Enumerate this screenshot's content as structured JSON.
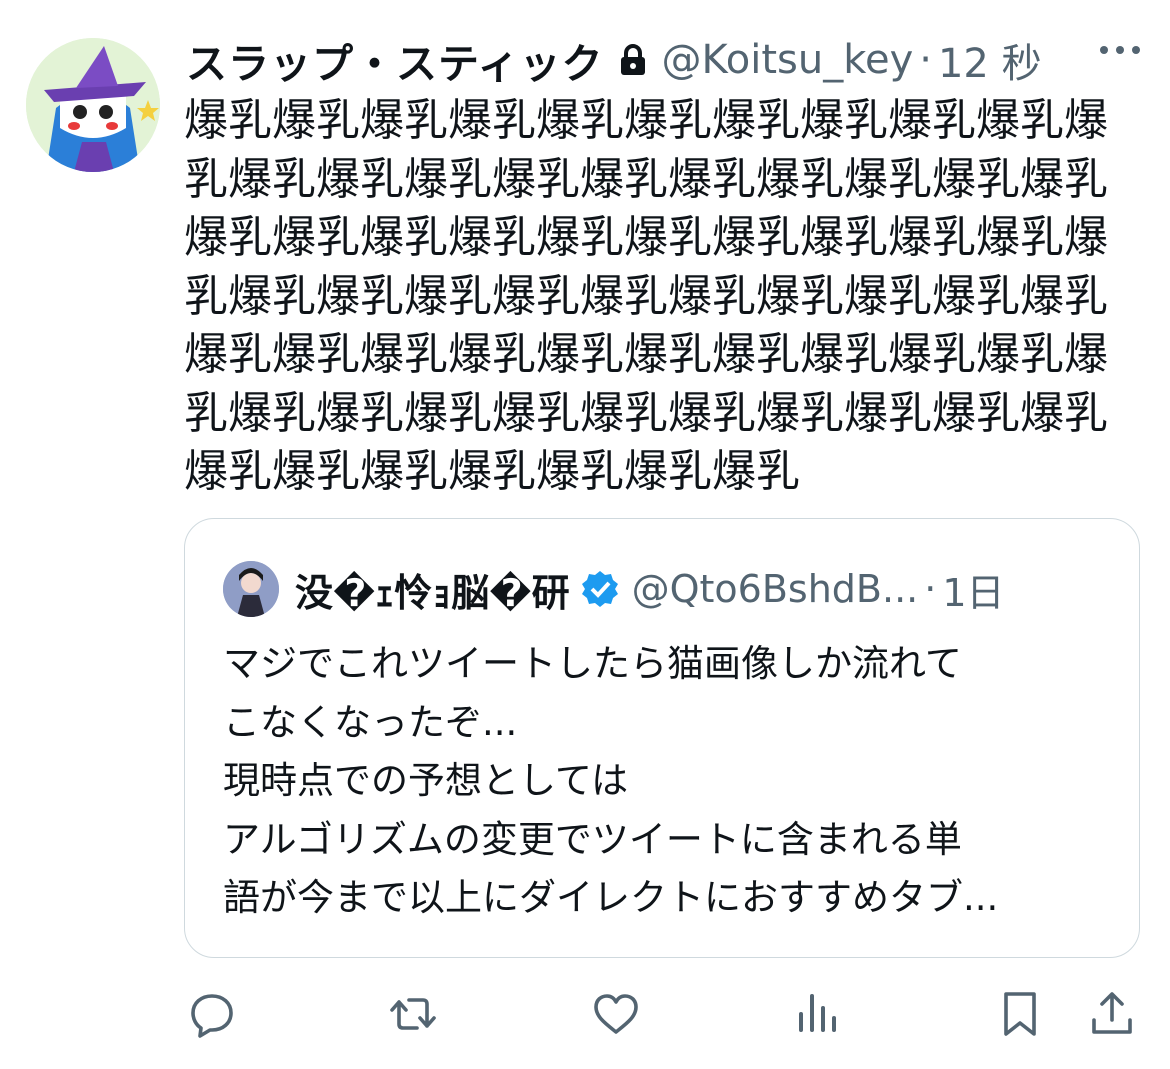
{
  "tweet": {
    "author_name": "スラップ・スティック",
    "handle": "@Koitsu_key",
    "separator": "·",
    "time": "12 秒",
    "body": "爆乳爆乳爆乳爆乳爆乳爆乳爆乳爆乳爆乳爆乳爆乳爆乳爆乳爆乳爆乳爆乳爆乳爆乳爆乳爆乳爆乳爆乳爆乳爆乳爆乳爆乳爆乳爆乳爆乳爆乳爆乳爆乳爆乳爆乳爆乳爆乳爆乳爆乳爆乳爆乳爆乳爆乳爆乳爆乳爆乳爆乳爆乳爆乳爆乳爆乳爆乳爆乳爆乳爆乳爆乳爆乳爆乳爆乳爆乳爆乳爆乳爆乳爆乳爆乳爆乳爆乳爆乳爆乳爆乳爆乳",
    "icons": {
      "lock": "lock-icon",
      "more": "more-icon"
    }
  },
  "quote": {
    "author_name": "没�ｪ怜ｮ脳�研",
    "handle": "@Qto6BshdB...",
    "separator": "·",
    "time": "1日",
    "lines": [
      "マジでこれツイートしたら猫画像しか流れて",
      "こなくなったぞ...",
      "現時点での予想としては",
      "アルゴリズムの変更でツイートに含まれる単",
      "語が今まで以上にダイレクトにおすすめタブ..."
    ],
    "icons": {
      "verified": "verified-badge-icon"
    }
  },
  "actions": [
    "reply-icon",
    "retweet-icon",
    "like-icon",
    "analytics-icon",
    "bookmark-icon",
    "share-icon"
  ],
  "colors": {
    "text": "#0f1419",
    "secondary": "#536471",
    "verified": "#1d9bf0",
    "border": "#cfd9de"
  }
}
